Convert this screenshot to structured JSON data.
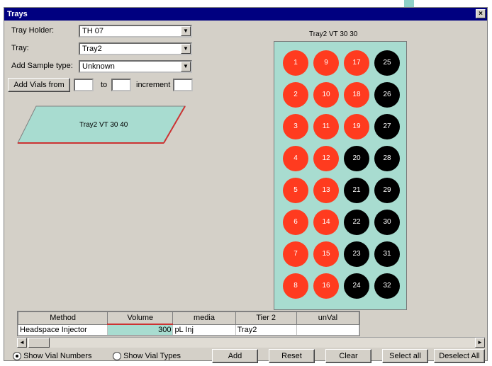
{
  "window": {
    "title": "Trays",
    "close_glyph": "×"
  },
  "form": {
    "tray_holder_label": "Tray Holder:",
    "tray_holder_value": "TH 07",
    "tray_label": "Tray:",
    "tray_value": "Tray2",
    "sample_type_label": "Add Sample type:",
    "sample_type_value": "Unknown",
    "add_vials_label": "Add Vials from",
    "to_label": "to",
    "increment_label": "increment"
  },
  "tray_shape_label": "Tray2 VT 30 40",
  "rack_title": "Tray2 VT 30 30",
  "wells": [
    {
      "label": "1",
      "color": "#ff3b1f"
    },
    {
      "label": "9",
      "color": "#ff3b1f"
    },
    {
      "label": "17",
      "color": "#ff3b1f"
    },
    {
      "label": "25",
      "color": "#000000"
    },
    {
      "label": "2",
      "color": "#ff3b1f"
    },
    {
      "label": "10",
      "color": "#ff3b1f"
    },
    {
      "label": "18",
      "color": "#ff3b1f"
    },
    {
      "label": "26",
      "color": "#000000"
    },
    {
      "label": "3",
      "color": "#ff3b1f"
    },
    {
      "label": "11",
      "color": "#ff3b1f"
    },
    {
      "label": "19",
      "color": "#ff3b1f"
    },
    {
      "label": "27",
      "color": "#000000"
    },
    {
      "label": "4",
      "color": "#ff3b1f"
    },
    {
      "label": "12",
      "color": "#ff3b1f"
    },
    {
      "label": "20",
      "color": "#000000"
    },
    {
      "label": "28",
      "color": "#000000"
    },
    {
      "label": "5",
      "color": "#ff3b1f"
    },
    {
      "label": "13",
      "color": "#ff3b1f"
    },
    {
      "label": "21",
      "color": "#000000"
    },
    {
      "label": "29",
      "color": "#000000"
    },
    {
      "label": "6",
      "color": "#ff3b1f"
    },
    {
      "label": "14",
      "color": "#ff3b1f"
    },
    {
      "label": "22",
      "color": "#000000"
    },
    {
      "label": "30",
      "color": "#000000"
    },
    {
      "label": "7",
      "color": "#ff3b1f"
    },
    {
      "label": "15",
      "color": "#ff3b1f"
    },
    {
      "label": "23",
      "color": "#000000"
    },
    {
      "label": "31",
      "color": "#000000"
    },
    {
      "label": "8",
      "color": "#ff3b1f"
    },
    {
      "label": "16",
      "color": "#ff3b1f"
    },
    {
      "label": "24",
      "color": "#000000"
    },
    {
      "label": "32",
      "color": "#000000"
    }
  ],
  "table": {
    "headers": [
      "Method",
      "Volume",
      "media",
      "Tier 2",
      "unVal"
    ],
    "rows": [
      [
        "Headspace Injector",
        "300",
        "pL Inj",
        "Tray2",
        ""
      ]
    ]
  },
  "bottom": {
    "radio1_label": "Show Vial Numbers",
    "radio2_label": "Show Vial Types",
    "add_button": "Add",
    "reset_button": "Reset",
    "clear_button": "Clear",
    "select_all_button": "Select all",
    "deselect_all_button": "Deselect All"
  }
}
